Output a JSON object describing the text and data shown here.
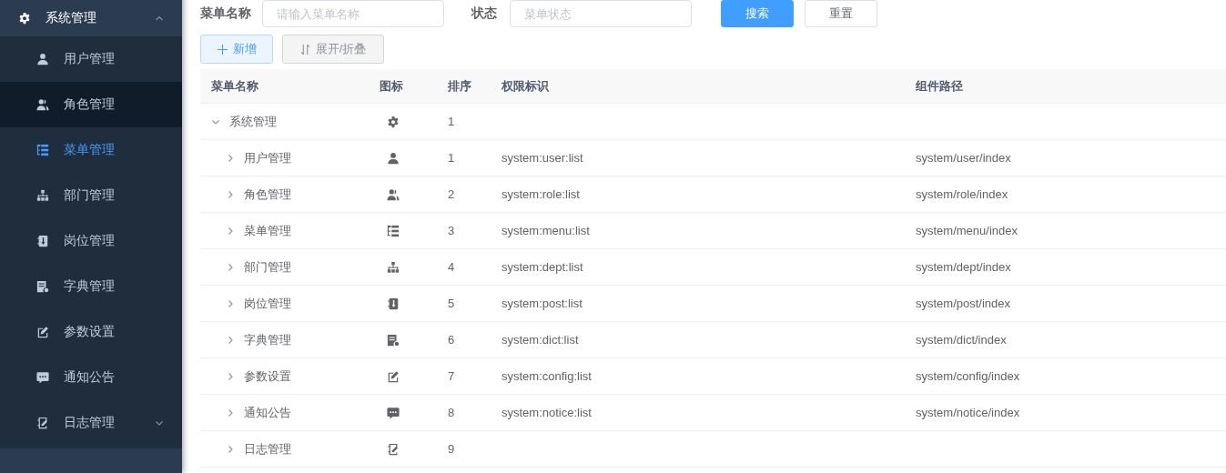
{
  "sidebar": {
    "group": {
      "label": "系统管理",
      "expanded": true
    },
    "items": [
      {
        "label": "用户管理",
        "selected": false,
        "hovered": false
      },
      {
        "label": "角色管理",
        "selected": false,
        "hovered": true
      },
      {
        "label": "菜单管理",
        "selected": true,
        "hovered": false
      },
      {
        "label": "部门管理",
        "selected": false,
        "hovered": false
      },
      {
        "label": "岗位管理",
        "selected": false,
        "hovered": false
      },
      {
        "label": "字典管理",
        "selected": false,
        "hovered": false
      },
      {
        "label": "参数设置",
        "selected": false,
        "hovered": false
      },
      {
        "label": "通知公告",
        "selected": false,
        "hovered": false
      },
      {
        "label": "日志管理",
        "selected": false,
        "hovered": false,
        "expanded": false
      }
    ]
  },
  "search_form": {
    "name_label": "菜单名称",
    "name_placeholder": "请输入菜单名称",
    "status_label": "状态",
    "status_placeholder": "菜单状态",
    "search_button": "搜索",
    "reset_button": "重置"
  },
  "toolbar": {
    "add_button": "新增",
    "toggle_button": "展开/折叠"
  },
  "table": {
    "columns": [
      "菜单名称",
      "图标",
      "排序",
      "权限标识",
      "组件路径"
    ],
    "rows": [
      {
        "name": "系统管理",
        "order": "1",
        "expanded": true,
        "children": [
          {
            "name": "用户管理",
            "order": "1",
            "perms": "system:user:list",
            "component": "system/user/index",
            "expanded": false
          },
          {
            "name": "角色管理",
            "order": "2",
            "perms": "system:role:list",
            "component": "system/role/index",
            "expanded": false
          },
          {
            "name": "菜单管理",
            "order": "3",
            "perms": "system:menu:list",
            "component": "system/menu/index",
            "expanded": false
          },
          {
            "name": "部门管理",
            "order": "4",
            "perms": "system:dept:list",
            "component": "system/dept/index",
            "expanded": false
          },
          {
            "name": "岗位管理",
            "order": "5",
            "perms": "system:post:list",
            "component": "system/post/index",
            "expanded": false
          },
          {
            "name": "字典管理",
            "order": "6",
            "perms": "system:dict:list",
            "component": "system/dict/index",
            "expanded": false
          },
          {
            "name": "参数设置",
            "order": "7",
            "perms": "system:config:list",
            "component": "system/config/index",
            "expanded": false
          },
          {
            "name": "通知公告",
            "order": "8",
            "perms": "system:notice:list",
            "component": "system/notice/index",
            "expanded": false
          },
          {
            "name": "日志管理",
            "order": "9",
            "expanded": false
          }
        ]
      }
    ]
  }
}
